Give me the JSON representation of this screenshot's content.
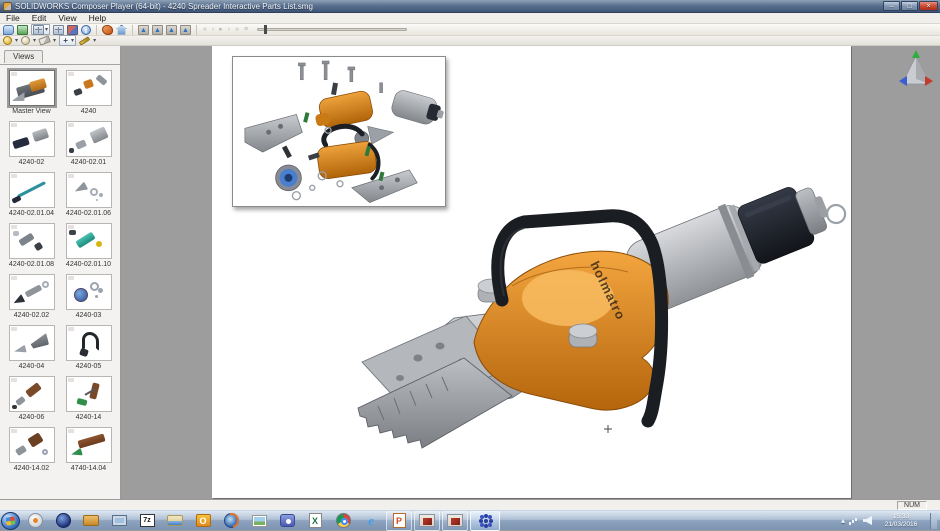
{
  "window": {
    "title": "SOLIDWORKS Composer Player (64-bit) - 4240 Spreader Interactive Parts List.smg",
    "controls": {
      "minimize": "–",
      "maximize": "□",
      "close": "×"
    }
  },
  "menu": {
    "items": [
      "File",
      "Edit",
      "View",
      "Help"
    ]
  },
  "glyphs": {
    "caret": "▾",
    "info": "i",
    "export": "▲",
    "move": "+",
    "chevron": "▴"
  },
  "toolbars": {
    "row1_icon_names": [
      "comment-icon",
      "paste-view-icon",
      "camera-views-icon",
      "multi-pane-icon",
      "link-icon",
      "info-icon",
      "publish-icon",
      "home-view-icon",
      "export-image-icon",
      "export-image-2-icon",
      "export-image-3-icon",
      "export-image-4-icon"
    ],
    "row2_icon_names": [
      "orbit-sphere-icon",
      "render-sphere-icon",
      "eraser-icon",
      "pan-move-icon",
      "wand-icon"
    ],
    "playback": [
      "«",
      "‹",
      "▸",
      "›",
      "»",
      "≡"
    ]
  },
  "views_panel": {
    "tab": "Views",
    "items": [
      {
        "label": "Master View",
        "selected": true
      },
      {
        "label": "4240",
        "selected": false
      },
      {
        "label": "4240-02",
        "selected": false
      },
      {
        "label": "4240-02.01",
        "selected": false
      },
      {
        "label": "4240-02.01.04",
        "selected": false
      },
      {
        "label": "4240-02.01.06",
        "selected": false
      },
      {
        "label": "4240-02.01.08",
        "selected": false
      },
      {
        "label": "4240-02.01.10",
        "selected": false
      },
      {
        "label": "4240-02.02",
        "selected": false
      },
      {
        "label": "4240-03",
        "selected": false
      },
      {
        "label": "4240-04",
        "selected": false
      },
      {
        "label": "4240-05",
        "selected": false
      },
      {
        "label": "4240-06",
        "selected": false
      },
      {
        "label": "4240-14",
        "selected": false
      },
      {
        "label": "4240-14.02",
        "selected": false
      },
      {
        "label": "4740-14.04",
        "selected": false
      }
    ]
  },
  "canvas": {
    "brand": "holmatro"
  },
  "status": {
    "num": "NUM"
  },
  "taskbar": {
    "icons": [
      {
        "name": "start-button"
      },
      {
        "name": "media-player"
      },
      {
        "name": "web-browser"
      },
      {
        "name": "folder"
      },
      {
        "name": "remote-viewer"
      },
      {
        "name": "seven-zip",
        "glyph": "7z"
      },
      {
        "name": "file-explorer"
      },
      {
        "name": "outlook",
        "glyph": "O"
      },
      {
        "name": "firefox"
      },
      {
        "name": "photo-viewer"
      },
      {
        "name": "messenger"
      },
      {
        "name": "excel",
        "glyph": "X"
      },
      {
        "name": "chrome"
      },
      {
        "name": "internet-explorer",
        "glyph": "e"
      },
      {
        "name": "powerpoint",
        "glyph": "P"
      },
      {
        "name": "composer-document-1"
      },
      {
        "name": "composer-document-2"
      },
      {
        "name": "composer-player"
      }
    ],
    "tray": {
      "time": "15:33",
      "date": "21/03/2016"
    }
  }
}
